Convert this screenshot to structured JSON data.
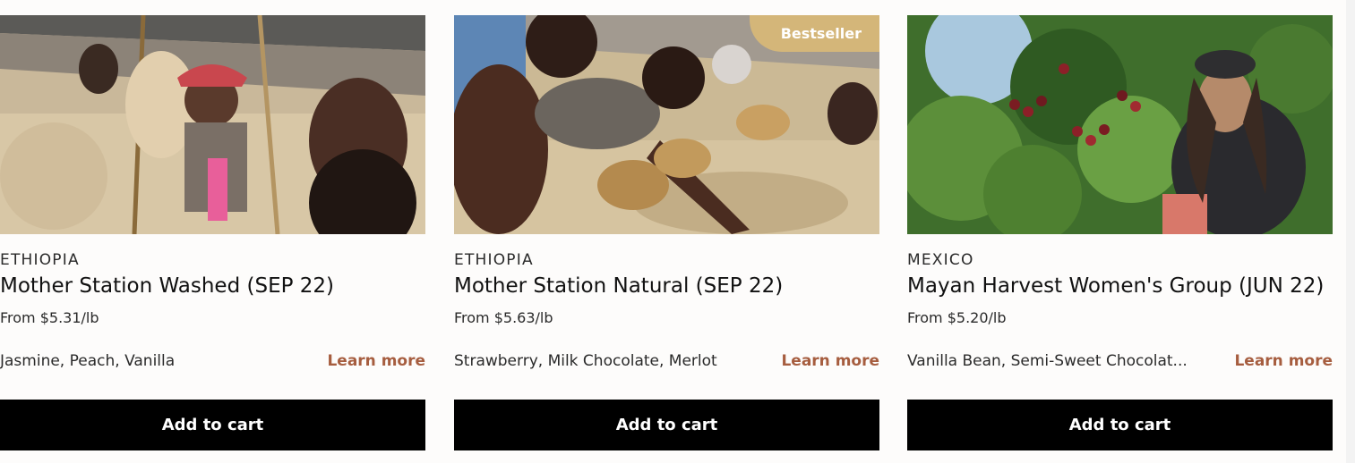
{
  "products": [
    {
      "origin": "ETHIOPIA",
      "name": "Mother Station Washed (SEP 22)",
      "price": "From $5.31/lb",
      "notes": "Jasmine, Peach, Vanilla",
      "learn_more": "Learn more",
      "add_to_cart": "Add to cart",
      "image_alt": "Coffee workers sorting beans on raised drying beds"
    },
    {
      "origin": "ETHIOPIA",
      "name": "Mother Station Natural (SEP 22)",
      "price": "From $5.63/lb",
      "notes": "Strawberry, Milk Chocolate, Merlot",
      "learn_more": "Learn more",
      "add_to_cart": "Add to cart",
      "badge": "Bestseller",
      "image_alt": "Workers hand-sorting natural coffee on drying beds"
    },
    {
      "origin": "MEXICO",
      "name": "Mayan Harvest Women's Group (JUN 22)",
      "price": "From $5.20/lb",
      "notes": "Vanilla Bean, Semi-Sweet Chocolat...",
      "learn_more": "Learn more",
      "add_to_cart": "Add to cart",
      "image_alt": "Smiling coffee farmer beside a coffee plant with ripe cherries"
    }
  ],
  "colors": {
    "accent": "#a65d3f",
    "badge": "#d4b679",
    "button": "#000000",
    "background": "#fdfcfb"
  }
}
